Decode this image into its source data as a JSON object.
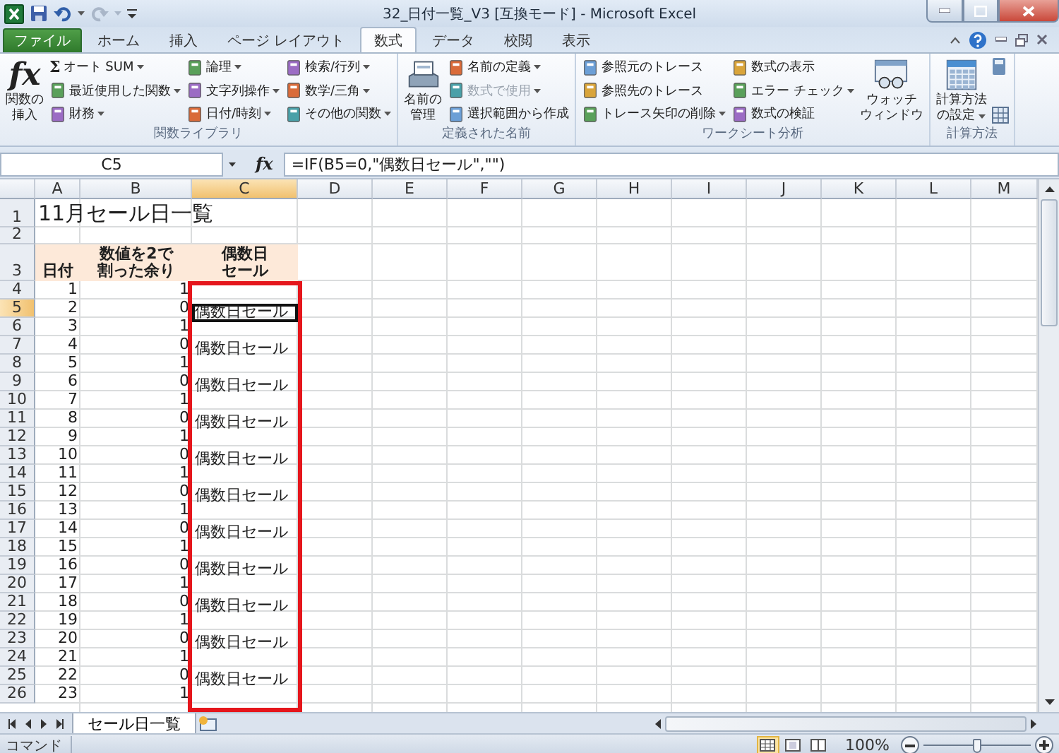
{
  "title_bar": {
    "title": "32_日付一覧_V3  [互換モード]  -  Microsoft Excel"
  },
  "ribbon_tabs": [
    {
      "label": "ファイル",
      "kind": "file",
      "selected": false
    },
    {
      "label": "ホーム",
      "kind": "tab",
      "selected": false
    },
    {
      "label": "挿入",
      "kind": "tab",
      "selected": false
    },
    {
      "label": "ページ レイアウト",
      "kind": "tab",
      "selected": false
    },
    {
      "label": "数式",
      "kind": "tab",
      "selected": true
    },
    {
      "label": "データ",
      "kind": "tab",
      "selected": false
    },
    {
      "label": "校閲",
      "kind": "tab",
      "selected": false
    },
    {
      "label": "表示",
      "kind": "tab",
      "selected": false
    }
  ],
  "ribbon_groups": [
    {
      "label": "関数ライブラリ",
      "items": [
        {
          "kind": "large",
          "glyph": "fx",
          "lines": [
            "関数の",
            "挿入"
          ],
          "dropdown": false
        },
        {
          "kind": "stack",
          "buttons": [
            {
              "label": "オート SUM",
              "glyph": "Σ",
              "dropdown": true,
              "disabled": false
            },
            {
              "label": "最近使用した関数",
              "dropdown": true,
              "disabled": false
            },
            {
              "label": "財務",
              "dropdown": true,
              "disabled": false
            }
          ]
        },
        {
          "kind": "stack",
          "buttons": [
            {
              "label": "論理",
              "dropdown": true,
              "disabled": false
            },
            {
              "label": "文字列操作",
              "dropdown": true,
              "disabled": false
            },
            {
              "label": "日付/時刻",
              "dropdown": true,
              "disabled": false
            }
          ]
        },
        {
          "kind": "stack",
          "buttons": [
            {
              "label": "検索/行列",
              "dropdown": true,
              "disabled": false
            },
            {
              "label": "数学/三角",
              "dropdown": true,
              "disabled": false
            },
            {
              "label": "その他の関数",
              "dropdown": true,
              "disabled": false
            }
          ]
        }
      ]
    },
    {
      "label": "定義された名前",
      "items": [
        {
          "kind": "large",
          "lines": [
            "名前の",
            "管理"
          ],
          "dropdown": false
        },
        {
          "kind": "stack",
          "buttons": [
            {
              "label": "名前の定義",
              "dropdown": true,
              "disabled": false
            },
            {
              "label": "数式で使用",
              "dropdown": true,
              "disabled": true
            },
            {
              "label": "選択範囲から作成",
              "dropdown": false,
              "disabled": false
            }
          ]
        }
      ]
    },
    {
      "label": "ワークシート分析",
      "items": [
        {
          "kind": "stack",
          "buttons": [
            {
              "label": "参照元のトレース",
              "dropdown": false,
              "disabled": false
            },
            {
              "label": "参照先のトレース",
              "dropdown": false,
              "disabled": false
            },
            {
              "label": "トレース矢印の削除",
              "dropdown": true,
              "disabled": false
            }
          ]
        },
        {
          "kind": "stack",
          "buttons": [
            {
              "label": "数式の表示",
              "dropdown": false,
              "disabled": false
            },
            {
              "label": "エラー チェック",
              "dropdown": true,
              "disabled": false
            },
            {
              "label": "数式の検証",
              "dropdown": false,
              "disabled": false
            }
          ]
        },
        {
          "kind": "large",
          "lines": [
            "ウォッチ",
            "ウィンドウ"
          ],
          "dropdown": false
        }
      ]
    },
    {
      "label": "計算方法",
      "items": [
        {
          "kind": "large",
          "lines": [
            "計算方法",
            "の設定"
          ],
          "dropdown": true
        },
        {
          "kind": "icons"
        }
      ]
    }
  ],
  "formula_bar": {
    "name_box": "C5",
    "fx_glyph": "fx",
    "formula": "=IF(B5=0,\"偶数日セール\",\"\")"
  },
  "columns": [
    {
      "label": "A",
      "selected": false,
      "framed": false
    },
    {
      "label": "B",
      "selected": false,
      "framed": false
    },
    {
      "label": "C",
      "selected": true,
      "framed": true
    },
    {
      "label": "D",
      "selected": false,
      "framed": false
    },
    {
      "label": "E",
      "selected": false,
      "framed": false
    },
    {
      "label": "F",
      "selected": false,
      "framed": false
    },
    {
      "label": "G",
      "selected": false,
      "framed": false
    },
    {
      "label": "H",
      "selected": false,
      "framed": false
    },
    {
      "label": "I",
      "selected": false,
      "framed": false
    },
    {
      "label": "J",
      "selected": false,
      "framed": false
    },
    {
      "label": "K",
      "selected": false,
      "framed": false
    },
    {
      "label": "L",
      "selected": false,
      "framed": false
    },
    {
      "label": "M",
      "selected": false,
      "framed": false
    }
  ],
  "rows": [
    {
      "number": "1",
      "kind": "title",
      "selected": false,
      "cells": [
        "11月セール日一覧"
      ]
    },
    {
      "number": "2",
      "kind": "blank",
      "selected": false
    },
    {
      "number": "3",
      "kind": "header",
      "selected": false,
      "cells": [
        [
          "日付"
        ],
        [
          "数値を2で",
          "割った余り"
        ],
        [
          "偶数日",
          "セール"
        ]
      ]
    },
    {
      "number": "4",
      "kind": "data",
      "selected": false,
      "cells": [
        "1",
        "1"
      ]
    },
    {
      "number": "5",
      "kind": "data",
      "selected": true,
      "cells": [
        "2",
        "0",
        "偶数日セール"
      ]
    },
    {
      "number": "6",
      "kind": "data",
      "selected": false,
      "cells": [
        "3",
        "1"
      ]
    },
    {
      "number": "7",
      "kind": "data",
      "selected": false,
      "cells": [
        "4",
        "0",
        "偶数日セール"
      ]
    },
    {
      "number": "8",
      "kind": "data",
      "selected": false,
      "cells": [
        "5",
        "1"
      ]
    },
    {
      "number": "9",
      "kind": "data",
      "selected": false,
      "cells": [
        "6",
        "0",
        "偶数日セール"
      ]
    },
    {
      "number": "10",
      "kind": "data",
      "selected": false,
      "cells": [
        "7",
        "1"
      ]
    },
    {
      "number": "11",
      "kind": "data",
      "selected": false,
      "cells": [
        "8",
        "0",
        "偶数日セール"
      ]
    },
    {
      "number": "12",
      "kind": "data",
      "selected": false,
      "cells": [
        "9",
        "1"
      ]
    },
    {
      "number": "13",
      "kind": "data",
      "selected": false,
      "cells": [
        "10",
        "0",
        "偶数日セール"
      ]
    },
    {
      "number": "14",
      "kind": "data",
      "selected": false,
      "cells": [
        "11",
        "1"
      ]
    },
    {
      "number": "15",
      "kind": "data",
      "selected": false,
      "cells": [
        "12",
        "0",
        "偶数日セール"
      ]
    },
    {
      "number": "16",
      "kind": "data",
      "selected": false,
      "cells": [
        "13",
        "1"
      ]
    },
    {
      "number": "17",
      "kind": "data",
      "selected": false,
      "cells": [
        "14",
        "0",
        "偶数日セール"
      ]
    },
    {
      "number": "18",
      "kind": "data",
      "selected": false,
      "cells": [
        "15",
        "1"
      ]
    },
    {
      "number": "19",
      "kind": "data",
      "selected": false,
      "cells": [
        "16",
        "0",
        "偶数日セール"
      ]
    },
    {
      "number": "20",
      "kind": "data",
      "selected": false,
      "cells": [
        "17",
        "1"
      ]
    },
    {
      "number": "21",
      "kind": "data",
      "selected": false,
      "cells": [
        "18",
        "0",
        "偶数日セール"
      ]
    },
    {
      "number": "22",
      "kind": "data",
      "selected": false,
      "cells": [
        "19",
        "1"
      ]
    },
    {
      "number": "23",
      "kind": "data",
      "selected": false,
      "cells": [
        "20",
        "0",
        "偶数日セール"
      ]
    },
    {
      "number": "24",
      "kind": "data",
      "selected": false,
      "cells": [
        "21",
        "1"
      ]
    },
    {
      "number": "25",
      "kind": "data",
      "selected": false,
      "cells": [
        "22",
        "0",
        "偶数日セール"
      ]
    },
    {
      "number": "26",
      "kind": "data",
      "selected": false,
      "cells": [
        "23",
        "1"
      ]
    }
  ],
  "sheet_tabs": [
    {
      "label": "セール日一覧",
      "selected": true
    }
  ],
  "status_bar": {
    "mode": "コマンド",
    "views": [
      {
        "kind": "normal",
        "selected": true
      },
      {
        "kind": "layout",
        "selected": false
      },
      {
        "kind": "pagebreak",
        "selected": false
      }
    ],
    "zoom": {
      "label": "100%",
      "level": 0.5
    }
  }
}
